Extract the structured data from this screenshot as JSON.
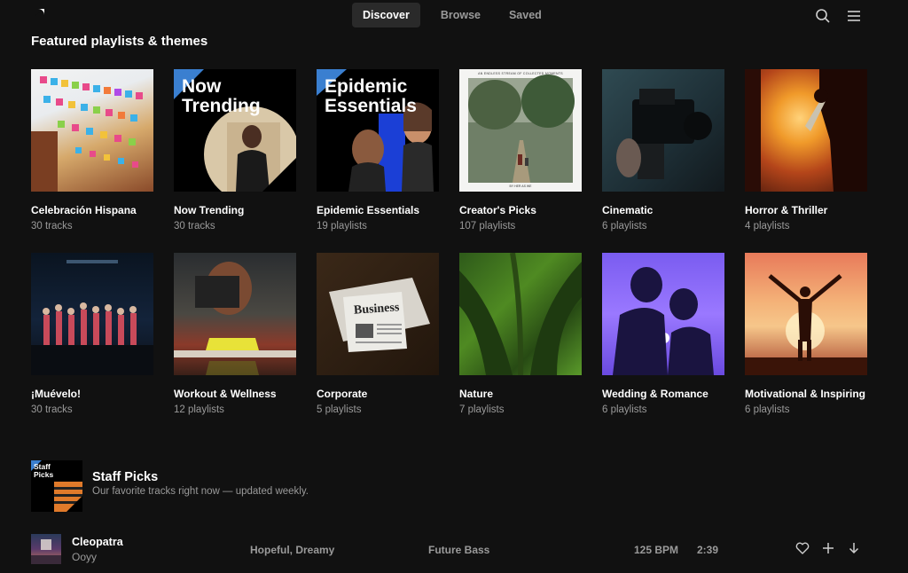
{
  "nav": {
    "tabs": [
      {
        "label": "Discover",
        "active": true
      },
      {
        "label": "Browse",
        "active": false
      },
      {
        "label": "Saved",
        "active": false
      }
    ]
  },
  "icons": {
    "logo": "brand-logo-icon",
    "search": "search-icon",
    "menu": "hamburger-menu-icon"
  },
  "featured": {
    "title": "Featured playlists & themes",
    "cards": [
      {
        "title": "Celebración Hispana",
        "sub": "30 tracks"
      },
      {
        "title": "Now Trending",
        "sub": "30 tracks",
        "overlay": "Now Trending"
      },
      {
        "title": "Epidemic Essentials",
        "sub": "19 playlists",
        "overlay": "Epidemic Essentials"
      },
      {
        "title": "Creator's Picks",
        "sub": "107 playlists",
        "caption_top": "AN ENDLESS STREAM OF COLLECTED MOMENTS",
        "caption_bottom": "BY HER AS WE"
      },
      {
        "title": "Cinematic",
        "sub": "6 playlists"
      },
      {
        "title": "Horror & Thriller",
        "sub": "4 playlists"
      },
      {
        "title": "¡Muévelo!",
        "sub": "30 tracks"
      },
      {
        "title": "Workout & Wellness",
        "sub": "12 playlists"
      },
      {
        "title": "Corporate",
        "sub": "5 playlists",
        "overlay": "Business"
      },
      {
        "title": "Nature",
        "sub": "7 playlists"
      },
      {
        "title": "Wedding & Romance",
        "sub": "6 playlists"
      },
      {
        "title": "Motivational & Inspiring",
        "sub": "6 playlists"
      }
    ]
  },
  "staff_picks": {
    "art_label": "Staff Picks",
    "title": "Staff Picks",
    "subtitle": "Our favorite tracks right now — updated weekly."
  },
  "track": {
    "title": "Cleopatra",
    "artist": "Ooyy",
    "mood": "Hopeful, Dreamy",
    "genre": "Future Bass",
    "bpm": "125 BPM",
    "duration": "2:39"
  },
  "colors": {
    "background": "#111111",
    "text_secondary": "#9a9a9a",
    "active_tab_bg": "#2a2a2a"
  }
}
